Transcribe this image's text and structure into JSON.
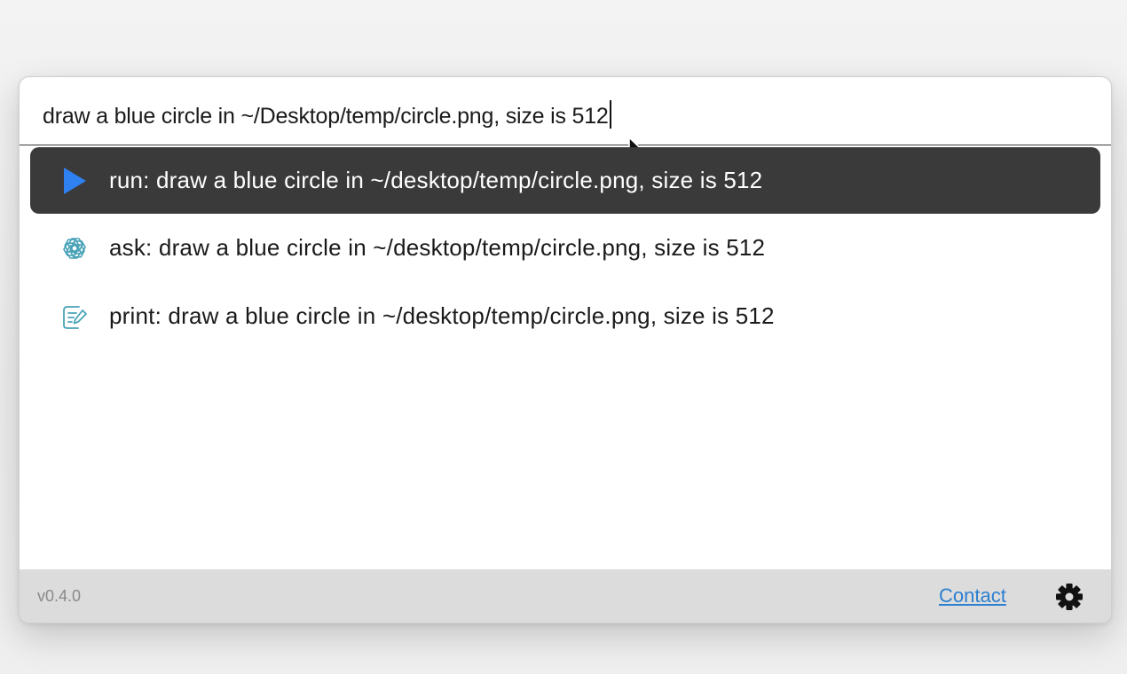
{
  "query": {
    "value": "draw a blue circle in ~/Desktop/temp/circle.png, size is 512"
  },
  "results": [
    {
      "icon": "play-icon",
      "label": "run: draw a blue circle in ~/desktop/temp/circle.png, size is 512",
      "selected": true
    },
    {
      "icon": "openai-icon",
      "label": "ask: draw a blue circle in ~/desktop/temp/circle.png, size is 512",
      "selected": false
    },
    {
      "icon": "note-edit-icon",
      "label": "print: draw a blue circle in ~/desktop/temp/circle.png, size is 512",
      "selected": false
    }
  ],
  "footer": {
    "version": "v0.4.0",
    "contact_label": "Contact",
    "settings_icon": "gear-icon"
  },
  "colors": {
    "selected_bg": "#3a3a3a",
    "play_accent": "#2f80f0",
    "link": "#2d7fd0",
    "footer_bg": "#dcdcdc",
    "icon_teal": "#4aa3b8"
  }
}
